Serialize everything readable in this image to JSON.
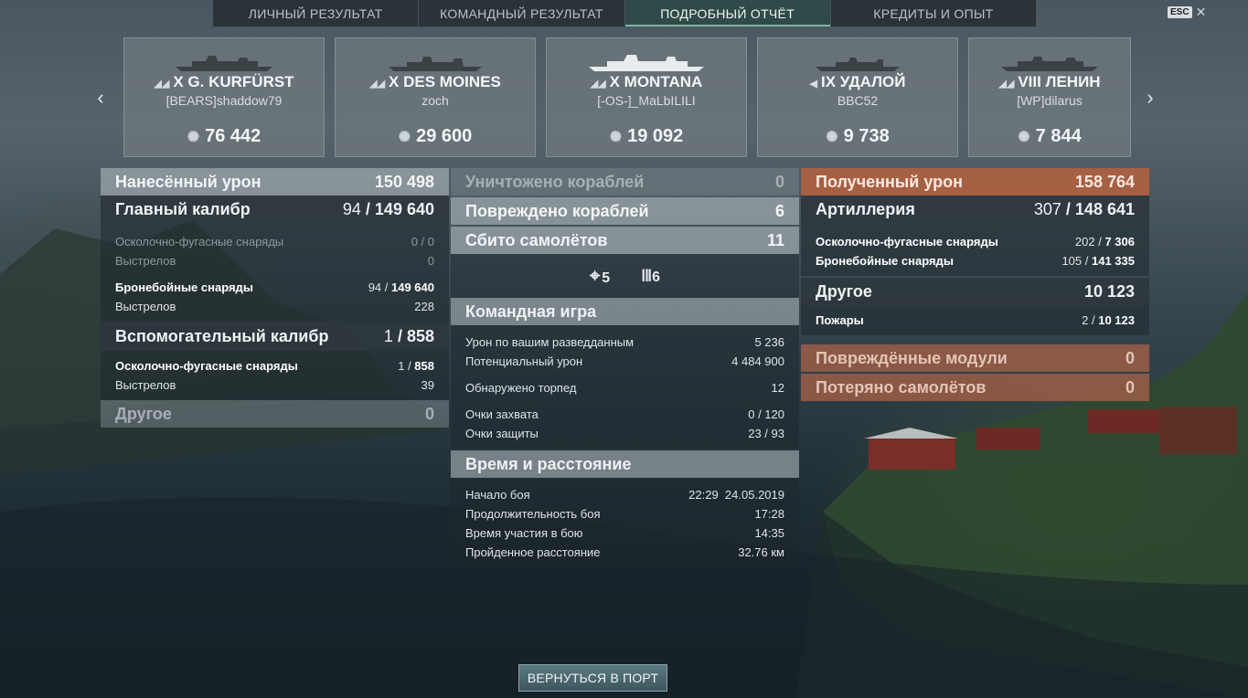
{
  "tabs": [
    {
      "label": "ЛИЧНЫЙ РЕЗУЛЬТАТ"
    },
    {
      "label": "КОМАНДНЫЙ РЕЗУЛЬТАТ"
    },
    {
      "label": "ПОДРОБНЫЙ ОТЧЁТ"
    },
    {
      "label": "КРЕДИТЫ И ОПЫТ"
    }
  ],
  "active_tab": "ПОДРОБНЫЙ ОТЧЁТ",
  "esc_label": "ESC",
  "close_glyph": "✕",
  "nav": {
    "prev_glyph": "‹",
    "next_glyph": "›"
  },
  "ships": [
    {
      "name": "X G. KURFÜRST",
      "player": "[BEARS]shaddow79",
      "damage": "76 442"
    },
    {
      "name": "X DES MOINES",
      "player": "zoch",
      "damage": "29 600"
    },
    {
      "name": "X MONTANA",
      "player": "[-OS-]_MaLbILILI",
      "damage": "19 092"
    },
    {
      "name": "IX УДАЛОЙ",
      "player": "BBC52",
      "damage": "9 738"
    },
    {
      "name": "VIII ЛЕНИН",
      "player": "[WP]dilarus",
      "damage": "7 844"
    }
  ],
  "left": {
    "dealt": {
      "label": "Нанесённый урон",
      "value": "150 498"
    },
    "main": {
      "label": "Главный калибр",
      "hits": "94",
      "dmg": "149 640"
    },
    "main_he": {
      "label": "Осколочно-фугасные снаряды",
      "value": "0 / 0"
    },
    "main_he_shots": {
      "label": "Выстрелов",
      "value": "0"
    },
    "main_ap": {
      "label": "Бронебойные снаряды",
      "hits": "94",
      "dmg": "149 640"
    },
    "main_ap_shots": {
      "label": "Выстрелов",
      "value": "228"
    },
    "secondary": {
      "label": "Вспомогательный калибр",
      "hits": "1",
      "dmg": "858"
    },
    "sec_he": {
      "label": "Осколочно-фугасные снаряды",
      "hits": "1",
      "dmg": "858"
    },
    "sec_shots": {
      "label": "Выстрелов",
      "value": "39"
    },
    "other": {
      "label": "Другое",
      "value": "0"
    }
  },
  "middle": {
    "destroyed": {
      "label": "Уничтожено кораблей",
      "value": "0"
    },
    "damaged": {
      "label": "Повреждено кораблей",
      "value": "6"
    },
    "planes": {
      "label": "Сбито самолётов",
      "value": "11"
    },
    "icon_hits": "5",
    "icon_ribbons": "6",
    "team": {
      "label": "Командная игра",
      "spotting": {
        "label": "Урон по вашим разведданным",
        "value": "5 236"
      },
      "potential": {
        "label": "Потенциальный урон",
        "value": "4 484 900"
      },
      "torps": {
        "label": "Обнаружено торпед",
        "value": "12"
      },
      "capture": {
        "label": "Очки захвата",
        "value": "0 / 120"
      },
      "defense": {
        "label": "Очки защиты",
        "value": "23 / 93"
      }
    },
    "time": {
      "label": "Время и расстояние",
      "start": {
        "label": "Начало боя",
        "value": "22:29  24.05.2019"
      },
      "duration": {
        "label": "Продолжительность боя",
        "value": "17:28"
      },
      "participation": {
        "label": "Время участия в бою",
        "value": "14:35"
      },
      "distance": {
        "label": "Пройденное расстояние",
        "value": "32.76 км"
      }
    }
  },
  "right": {
    "received": {
      "label": "Полученный урон",
      "value": "158 764"
    },
    "artillery": {
      "label": "Артиллерия",
      "hits": "307",
      "dmg": "148 641"
    },
    "art_he": {
      "label": "Осколочно-фугасные снаряды",
      "hits": "202",
      "dmg": "7 306"
    },
    "art_ap": {
      "label": "Бронебойные снаряды",
      "hits": "105",
      "dmg": "141 335"
    },
    "other": {
      "label": "Другое",
      "value": "10 123"
    },
    "fires": {
      "label": "Пожары",
      "hits": "2",
      "dmg": "10 123"
    },
    "modules": {
      "label": "Повреждённые модули",
      "value": "0"
    },
    "lost_planes": {
      "label": "Потеряно самолётов",
      "value": "0"
    }
  },
  "back_button": "ВЕРНУТЬСЯ В ПОРТ",
  "colors": {
    "accent_active_tab": "#2f4a48",
    "received_header": "#b06040"
  }
}
